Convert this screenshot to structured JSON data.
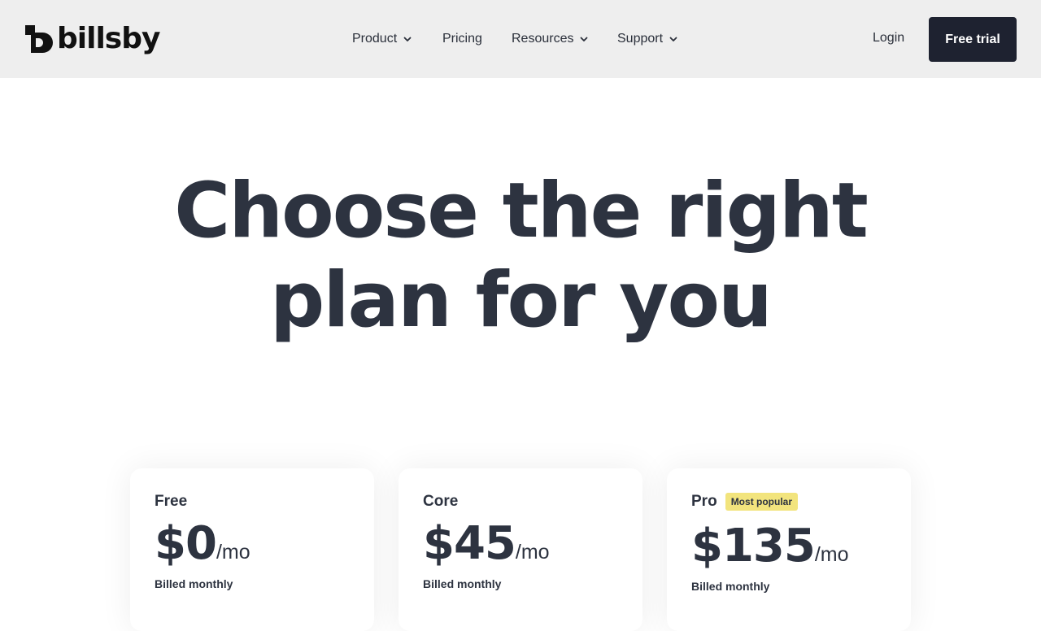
{
  "brand": {
    "name": "billsby"
  },
  "nav": {
    "items": [
      {
        "label": "Product",
        "dropdown": true
      },
      {
        "label": "Pricing",
        "dropdown": false
      },
      {
        "label": "Resources",
        "dropdown": true
      },
      {
        "label": "Support",
        "dropdown": true
      }
    ],
    "login_label": "Login",
    "cta_label": "Free trial"
  },
  "hero": {
    "line1": "Choose the right",
    "line2": "plan for you"
  },
  "plans": [
    {
      "name": "Free",
      "price": "$0",
      "period": "/mo",
      "billing": "Billed monthly"
    },
    {
      "name": "Core",
      "price": "$45",
      "period": "/mo",
      "billing": "Billed monthly"
    },
    {
      "name": "Pro",
      "badge": "Most popular",
      "price": "$135",
      "period": "/mo",
      "billing": "Billed monthly"
    }
  ],
  "colors": {
    "nav_background": "#eeeeee",
    "cta_background": "#1e2230",
    "text": "#2d3340",
    "badge_background": "#f2e47d"
  }
}
